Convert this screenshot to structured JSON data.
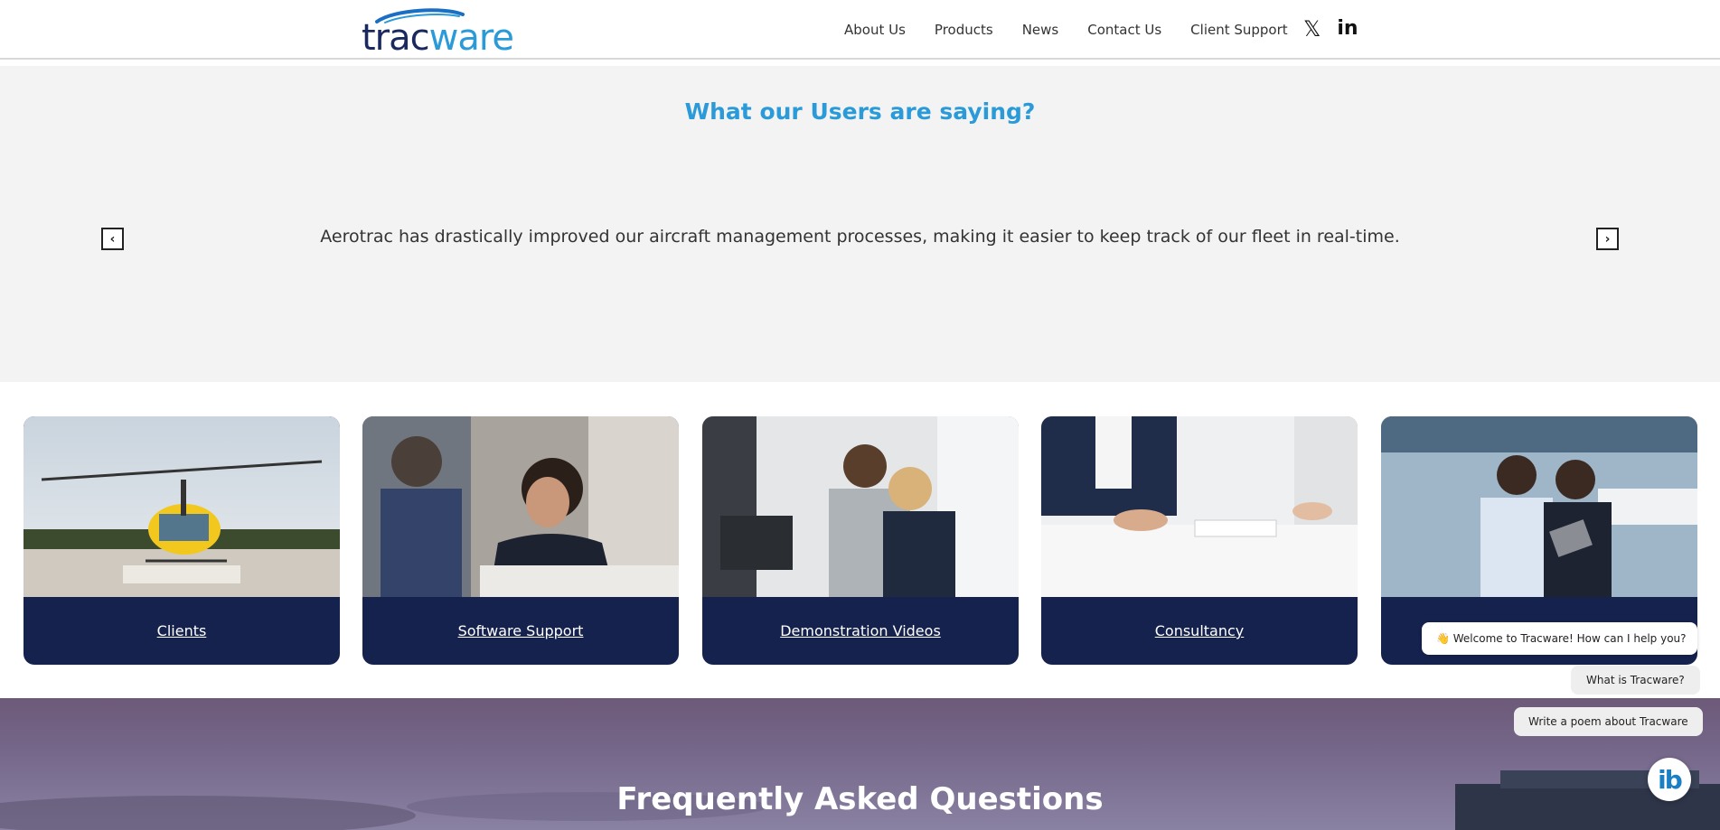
{
  "header": {
    "logo": {
      "part1": "trac",
      "part2": "ware"
    },
    "nav": [
      {
        "label": "About Us"
      },
      {
        "label": "Products"
      },
      {
        "label": "News"
      },
      {
        "label": "Contact Us"
      },
      {
        "label": "Client Support"
      }
    ],
    "social": {
      "x_icon": "x-icon",
      "linkedin_icon": "linkedin-icon",
      "x_glyph": "𝕏",
      "linkedin_glyph": "in"
    }
  },
  "testimonials": {
    "title": "What our Users are saying?",
    "quote": "Aerotrac has drastically improved our aircraft management processes, making it easier to keep track of our fleet in real-time.",
    "prev_glyph": "‹",
    "next_glyph": "›"
  },
  "cards": [
    {
      "label": "Clients"
    },
    {
      "label": "Software Support"
    },
    {
      "label": "Demonstration Videos"
    },
    {
      "label": "Consultancy"
    },
    {
      "label": ""
    }
  ],
  "faq": {
    "title": "Frequently Asked Questions"
  },
  "chat": {
    "welcome": "👋 Welcome to Tracware! How can I help you?",
    "suggestions": [
      "What is Tracware?",
      "Write a poem about Tracware"
    ],
    "launcher_label": "ib"
  },
  "colors": {
    "brand_navy": "#16224e",
    "brand_blue": "#2a9ad8",
    "testimonial_bg": "#f3f3f3"
  }
}
